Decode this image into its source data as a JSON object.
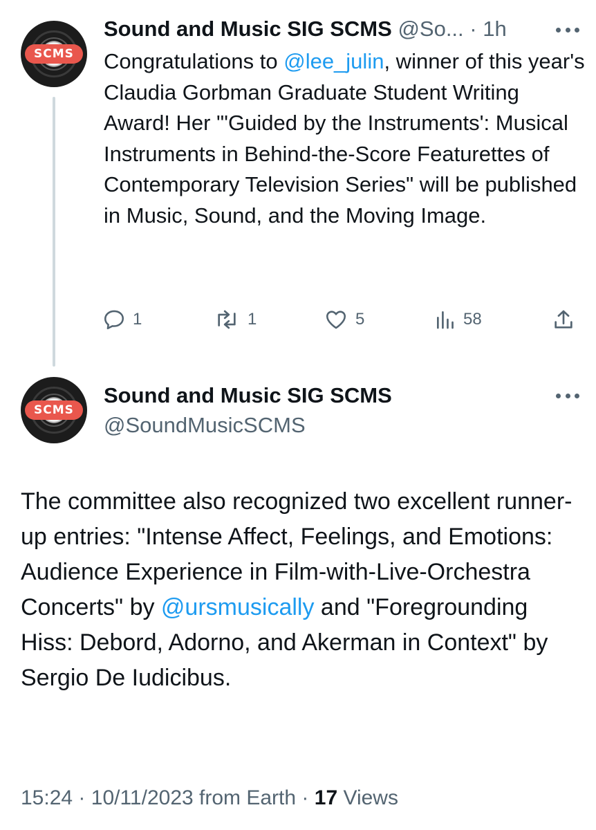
{
  "tweet1": {
    "avatar_text": "SCMS",
    "name": "Sound and Music SIG SCMS",
    "handle": "@So...",
    "separator": "·",
    "time": "1h",
    "text_before": "Congratulations to ",
    "mention": "@lee_julin",
    "text_after": ", winner of this year's Claudia Gorbman Graduate Student Writing Award! Her \"'Guided by the Instruments': Musical Instruments in Behind-the-Score Featurettes of Contemporary Television Series\" will be published in Music, Sound, and the Moving Image.",
    "actions": {
      "replies": "1",
      "retweets": "1",
      "likes": "5",
      "views": "58"
    }
  },
  "tweet2": {
    "avatar_text": "SCMS",
    "name": "Sound and Music SIG SCMS",
    "handle": "@SoundMusicSCMS",
    "text_part1": "The committee also recognized two excellent runner-up entries: \"Intense Affect, Feelings, and Emotions: Audience Experience in Film-with-Live-Orchestra Concerts\" by ",
    "mention": "@ursmusically",
    "text_part2": " and \"Foregrounding Hiss: Debord, Adorno, and Akerman in Context\" by Sergio De Iudicibus.",
    "footer": {
      "time": "15:24",
      "sep1": "·",
      "date": "10/11/2023",
      "source": "from Earth",
      "sep2": "·",
      "views_count": "17",
      "views_label": "Views"
    }
  },
  "colors": {
    "text": "#0f1419",
    "secondary": "#536471",
    "link": "#1d9bf0",
    "thread_line": "#cfd9de",
    "badge": "#e9574d"
  }
}
